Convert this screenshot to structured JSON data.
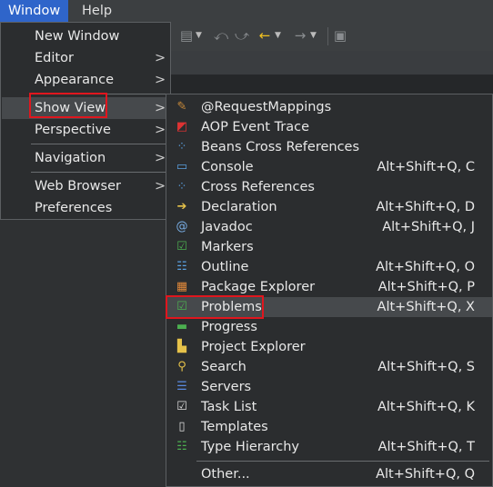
{
  "menubar": {
    "window": "Window",
    "help": "Help"
  },
  "window_menu": {
    "new_window": "New Window",
    "editor": "Editor",
    "appearance": "Appearance",
    "show_view": "Show View",
    "perspective": "Perspective",
    "navigation": "Navigation",
    "web_browser": "Web Browser",
    "preferences": "Preferences",
    "chevron": ">"
  },
  "show_view_menu": {
    "request_mappings": "@RequestMappings",
    "aop_event_trace": "AOP Event Trace",
    "beans_cross_references": "Beans Cross References",
    "console": "Console",
    "console_shortcut": "Alt+Shift+Q, C",
    "cross_references": "Cross References",
    "declaration": "Declaration",
    "declaration_shortcut": "Alt+Shift+Q, D",
    "javadoc": "Javadoc",
    "javadoc_shortcut": "Alt+Shift+Q, J",
    "markers": "Markers",
    "outline": "Outline",
    "outline_shortcut": "Alt+Shift+Q, O",
    "package_explorer": "Package Explorer",
    "package_explorer_shortcut": "Alt+Shift+Q, P",
    "problems": "Problems",
    "problems_shortcut": "Alt+Shift+Q, X",
    "progress": "Progress",
    "project_explorer": "Project Explorer",
    "search": "Search",
    "search_shortcut": "Alt+Shift+Q, S",
    "servers": "Servers",
    "task_list": "Task List",
    "task_list_shortcut": "Alt+Shift+Q, K",
    "templates": "Templates",
    "type_hierarchy": "Type Hierarchy",
    "type_hierarchy_shortcut": "Alt+Shift+Q, T",
    "other": "Other...",
    "other_shortcut": "Alt+Shift+Q, Q"
  },
  "colors": {
    "menubar_active": "#2f65ca",
    "highlight_outline": "#e0161e",
    "menu_bg": "#2b2d2f",
    "hover_bg": "#46494c"
  }
}
